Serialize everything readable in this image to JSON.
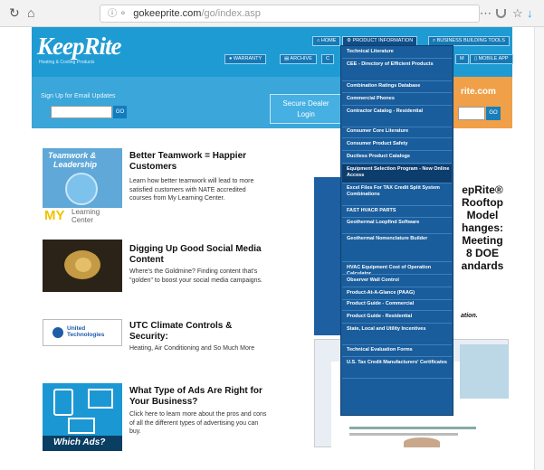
{
  "browser": {
    "url_host": "gokeeprite.com",
    "url_path": "/go/index.asp",
    "menu_icon": "⋯",
    "pocket_icon": "pocket-icon",
    "star_icon": "☆",
    "download_icon": "↓"
  },
  "header": {
    "logo": "KeepRite",
    "tagline": "Heating & Cooling Products",
    "nav": {
      "home": "HOME",
      "product_info": "PRODUCT INFORMATION",
      "business_tools": "BUSINESS BUILDING TOOLS",
      "warranty": "WARRANTY",
      "archive": "ARCHIVE",
      "c": "C",
      "m": "M",
      "mobile_app": "MOBILE APP"
    }
  },
  "band": {
    "signup": "Sign Up for Email Updates",
    "go": "GO",
    "secure_line1": "Secure Dealer",
    "secure_line2": "Login",
    "site": "rite.com",
    "go2": "GO"
  },
  "articles": [
    {
      "thumb_line1": "Teamwork &",
      "thumb_line2": "Leadership",
      "thumb_my": "MY",
      "thumb_lc1": "Learning",
      "thumb_lc2": "Center",
      "title": "Better Teamwork = Happier Customers",
      "body": "Learn how better teamwork will lead to more satisfied customers with NATE accredited courses from My Learning Center."
    },
    {
      "title": "Digging Up Good Social Media Content",
      "body": "Where's the Goldmine? Finding content that's \"golden\" to boost your social media campaigns."
    },
    {
      "thumb_logo1": "United",
      "thumb_logo2": "Technologies",
      "title": "UTC Climate Controls & Security:",
      "body": "Heating, Air Conditioning and So Much More"
    },
    {
      "thumb_caption": "Which Ads?",
      "title": "What Type of Ads Are Right for Your Business?",
      "body": "Click here to learn more about the pros and cons of all the different types of advertising you can buy."
    }
  ],
  "promo": {
    "lines": [
      "epRite®",
      "Rooftop",
      "Model",
      "hanges:",
      "Meeting",
      "8 DOE",
      "andards"
    ],
    "footer": "ation."
  },
  "menu": {
    "items": [
      "Technical Literature",
      "CEE - Directory of Efficient Products",
      "Combination Ratings Database",
      "Commercial Phones",
      "Contractor Catalog - Residential",
      "Consumer Core Literature",
      "Consumer Product Safety",
      "Ductless Product Catalogs",
      "Equipment Selection Program - New Online Access",
      "Excel Files For TAX Credit Split System Combinations",
      "FAST HVACR PARTS",
      "Geothermal Loopfind Software",
      "Geothermal Nomenclature Builder",
      "HVAC Equipment Cost of Operation Calculator",
      "Observer Wall Control",
      "Product-At-A-Glance (PAAG)",
      "Product Guide - Commercial",
      "Product Guide - Residential",
      "State, Local and Utility Incentives",
      "Technical Evaluation Forms",
      "U.S. Tax Credit Manufacturers' Certificates"
    ]
  }
}
